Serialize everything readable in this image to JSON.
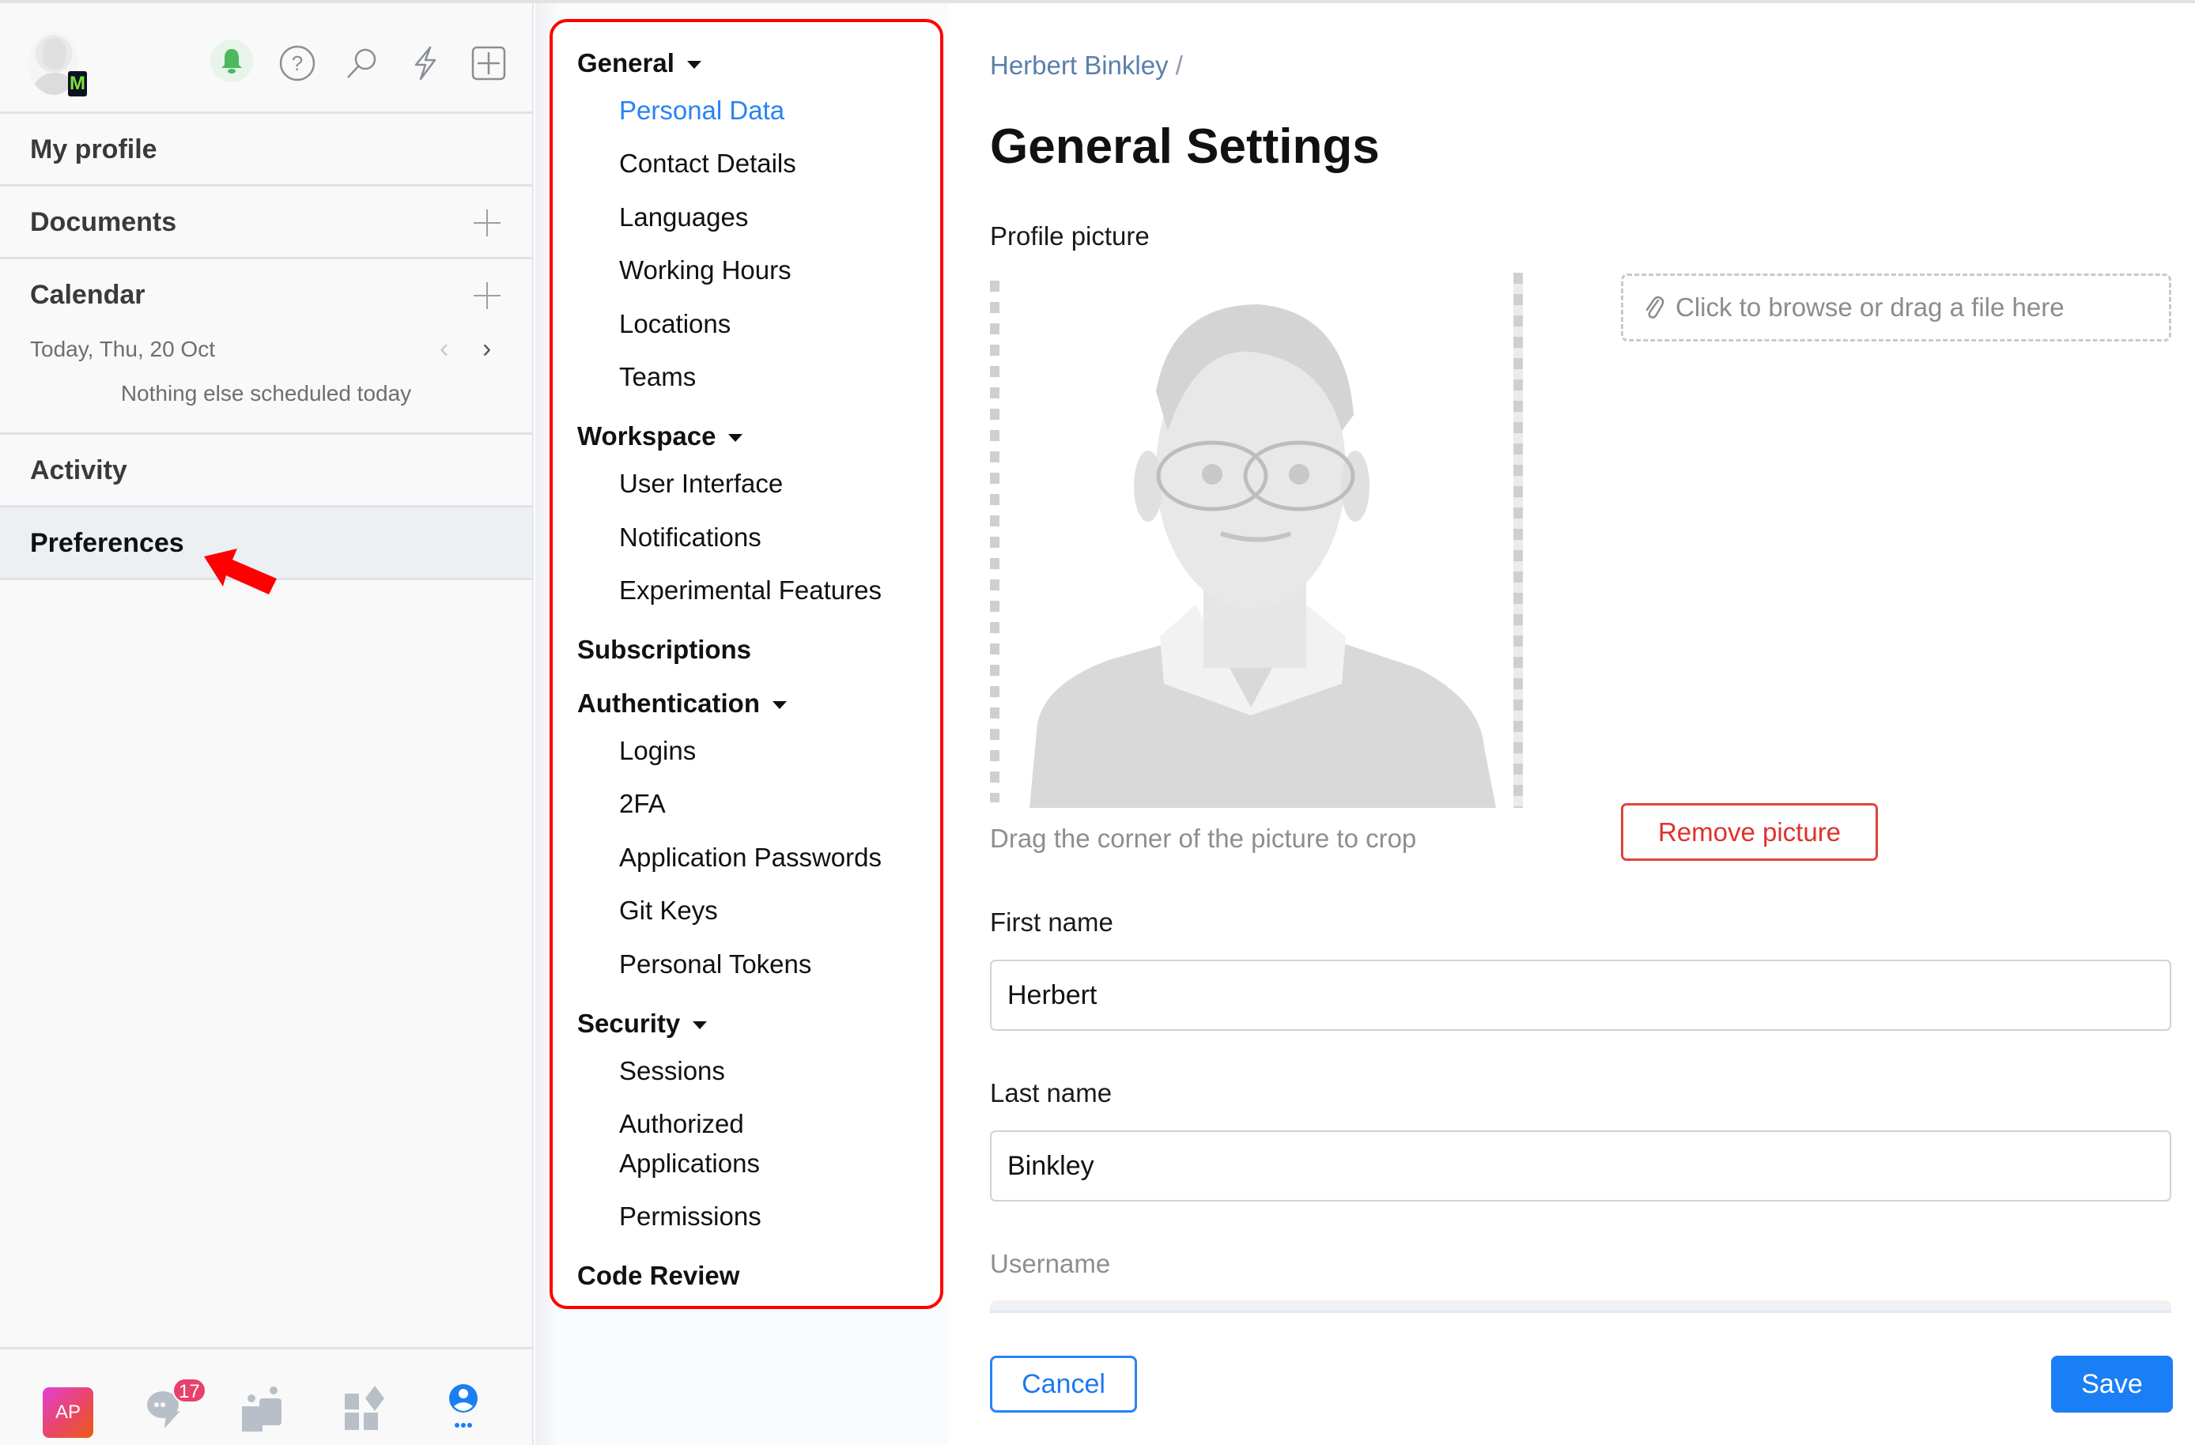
{
  "sidebar": {
    "header_icons": [
      "bell-icon",
      "help-icon",
      "search-icon",
      "lightning-icon",
      "add-square-icon"
    ],
    "workspace_badge": "M",
    "items": [
      {
        "label": "My profile",
        "has_add": false
      },
      {
        "label": "Documents",
        "has_add": true
      },
      {
        "label": "Calendar",
        "has_add": true
      },
      {
        "label": "Activity",
        "has_add": false
      },
      {
        "label": "Preferences",
        "has_add": false,
        "selected": true
      }
    ],
    "calendar": {
      "date": "Today, Thu, 20 Oct",
      "empty_text": "Nothing else scheduled today",
      "prev_icon": "chevron-left-icon",
      "next_icon": "chevron-right-icon"
    },
    "bottom_nav": {
      "app_initials": "AP",
      "chat_badge": "17",
      "icons": [
        "chat-icon",
        "people-icon",
        "apps-icon",
        "profile-icon"
      ]
    }
  },
  "settings_nav": {
    "groups": [
      {
        "label": "General",
        "expanded": true,
        "items": [
          "Personal Data",
          "Contact Details",
          "Languages",
          "Working Hours",
          "Locations",
          "Teams"
        ]
      },
      {
        "label": "Workspace",
        "expanded": true,
        "items": [
          "User Interface",
          "Notifications",
          "Experimental Features"
        ]
      },
      {
        "label": "Subscriptions",
        "expanded": false,
        "items": []
      },
      {
        "label": "Authentication",
        "expanded": true,
        "items": [
          "Logins",
          "2FA",
          "Application Passwords",
          "Git Keys",
          "Personal Tokens"
        ]
      },
      {
        "label": "Security",
        "expanded": true,
        "items": [
          "Sessions",
          "Authorized Applications",
          "Permissions"
        ]
      },
      {
        "label": "Code Review",
        "expanded": false,
        "items": []
      }
    ],
    "active_item": "Personal Data"
  },
  "main": {
    "breadcrumb": {
      "name": "Herbert Binkley",
      "separator": "/"
    },
    "title": "General Settings",
    "profile_picture": {
      "label": "Profile picture",
      "hint": "Drag the corner of the picture to crop",
      "drop_zone_text": "Click to browse or drag a file here",
      "remove_label": "Remove picture"
    },
    "first_name": {
      "label": "First name",
      "value": "Herbert"
    },
    "last_name": {
      "label": "Last name",
      "value": "Binkley"
    },
    "username": {
      "label": "Username",
      "value": ""
    },
    "cancel_label": "Cancel",
    "save_label": "Save"
  },
  "colors": {
    "accent": "#1a7ff5",
    "active_nav": "#2a82f6",
    "danger": "#e0312b",
    "annotation_red": "#ff0000",
    "badge": "#e8416b",
    "bell_green": "#4cb860"
  }
}
